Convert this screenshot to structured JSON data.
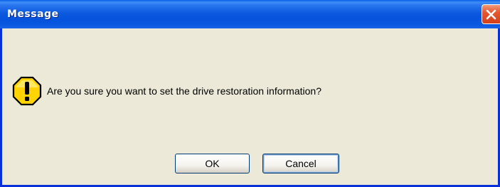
{
  "window": {
    "title": "Message",
    "close_icon": "close-icon"
  },
  "dialog": {
    "icon": "warning-icon",
    "message": "Are you sure you want to set the drive restoration information?"
  },
  "buttons": {
    "ok_label": "OK",
    "cancel_label": "Cancel"
  },
  "colors": {
    "titlebar_blue": "#0652dc",
    "dialog_background": "#ece9d8",
    "close_button_red": "#e4582f",
    "warning_yellow": "#ffd400"
  }
}
